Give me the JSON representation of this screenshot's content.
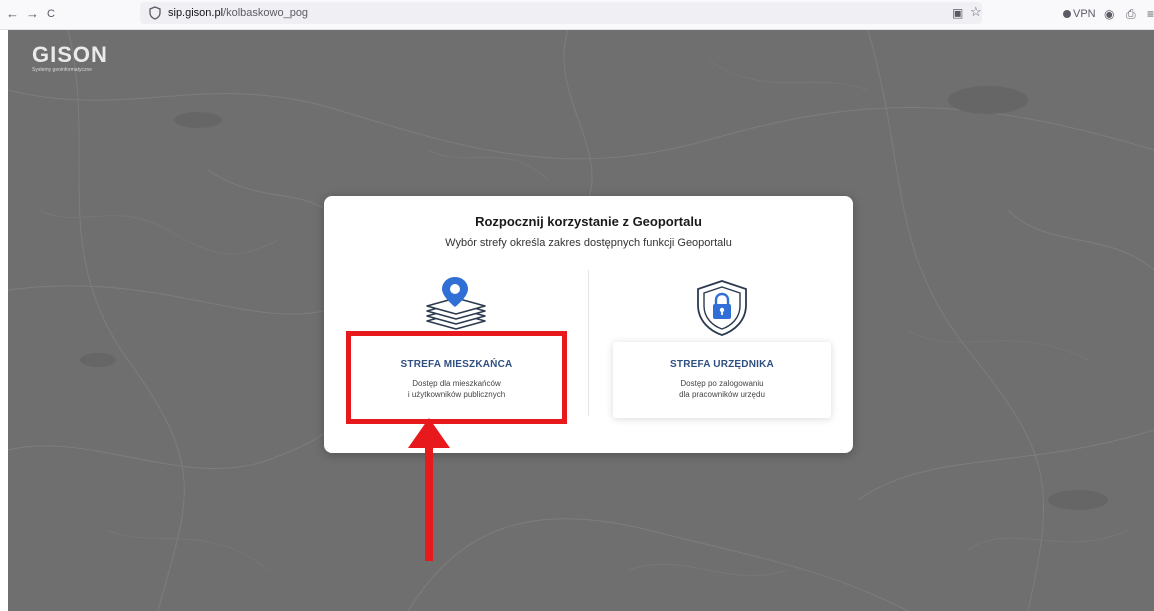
{
  "browser": {
    "back_icon": "←",
    "forward_icon": "→",
    "reload_icon": "C",
    "url_host": "sip.gison.pl",
    "url_path": "/kolbaskowo_pog",
    "reader_icon": "▣",
    "star_icon": "☆",
    "vpn_label": "VPN",
    "account_icon": "◉",
    "extensions_icon": "⎙",
    "menu_icon": "≡"
  },
  "logo": {
    "main": "GISON",
    "sub": "Systemy geoinformatyczne"
  },
  "dialog": {
    "title": "Rozpocznij korzystanie z Geoportalu",
    "subtitle": "Wybór strefy określa zakres dostępnych funkcji Geoportalu",
    "zones": [
      {
        "title": "STREFA MIESZKAŃCA",
        "desc_line1": "Dostęp dla mieszkańców",
        "desc_line2": "i użytkowników publicznych",
        "icon": "map-layers-pin-icon"
      },
      {
        "title": "STREFA URZĘDNIKA",
        "desc_line1": "Dostęp po zalogowaniu",
        "desc_line2": "dla pracowników urzędu",
        "icon": "shield-lock-icon"
      }
    ]
  },
  "colors": {
    "accent_blue": "#2f6fd6",
    "title_navy": "#2f4f80",
    "highlight_red": "#e8191c",
    "map_gray": "#6f6f6f"
  }
}
